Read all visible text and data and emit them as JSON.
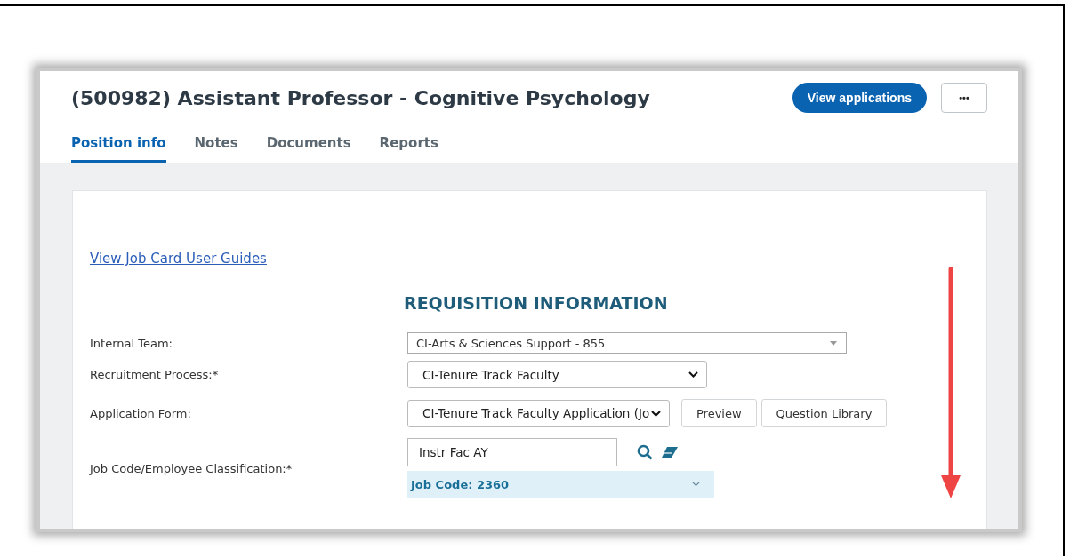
{
  "title": "(500982) Assistant Professor - Cognitive Psychology",
  "actions": {
    "primary": "View applications",
    "more": "•••"
  },
  "tabs": [
    {
      "label": "Position info",
      "selected": true
    },
    {
      "label": "Notes",
      "selected": false
    },
    {
      "label": "Documents",
      "selected": false
    },
    {
      "label": "Reports",
      "selected": false
    }
  ],
  "guide_link": "View Job Card User Guides",
  "section_heading": "REQUISITION INFORMATION",
  "fields": [
    {
      "kind": "flat-select",
      "label": "Internal Team:",
      "value": "CI-Arts & Sciences Support - 855"
    },
    {
      "kind": "select",
      "label": "Recruitment Process:*",
      "value": "CI-Tenure Track Faculty"
    },
    {
      "kind": "select-buttons",
      "label": "Application Form:",
      "value": "CI-Tenure Track Faculty Application (Jo",
      "buttons": [
        "Preview",
        "Question Library"
      ]
    },
    {
      "kind": "lookup",
      "label": "Job Code/Employee Classification:*",
      "value": "Instr Fac AY",
      "result": "Job Code: 2360"
    }
  ]
}
